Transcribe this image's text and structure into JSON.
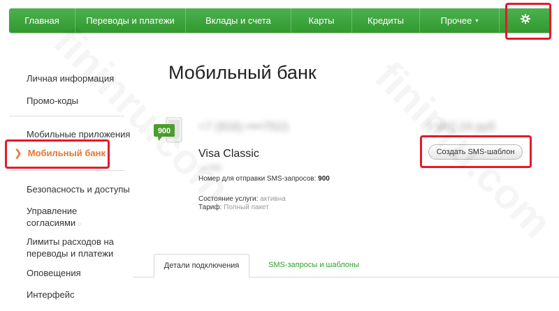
{
  "nav": {
    "items": [
      "Главная",
      "Переводы и платежи",
      "Вклады и счета",
      "Карты",
      "Кредиты",
      "Прочее"
    ],
    "more_caret": "▾",
    "settings_icon": "gear-icon",
    "accent_color": "#3aa23a"
  },
  "sidebar": {
    "items": [
      "Личная информация",
      "Промо-коды",
      "Мобильные приложения",
      "Мобильный банк",
      "Безопасность и доступы",
      "Управление согласиями",
      "Лимиты расходов на переводы и платежи",
      "Оповещения",
      "Интерфейс"
    ],
    "active_index": 3,
    "active_color": "#e8762d"
  },
  "main": {
    "title": "Мобильный банк",
    "phone_badge": "900",
    "card_name": "Visa Classic",
    "sms_number_label": "Номер для отправки SMS-запросов:",
    "sms_number": "900",
    "service_status_label": "Состояние услуги:",
    "service_status_value": "активна",
    "tariff_label": "Тариф:",
    "tariff_value": "Полный пакет",
    "create_template_button": "Создать SMS-шаблон"
  },
  "tabs": [
    "Детали подключения",
    "SMS-запросы и шаблоны"
  ],
  "watermark": "fininru.com"
}
